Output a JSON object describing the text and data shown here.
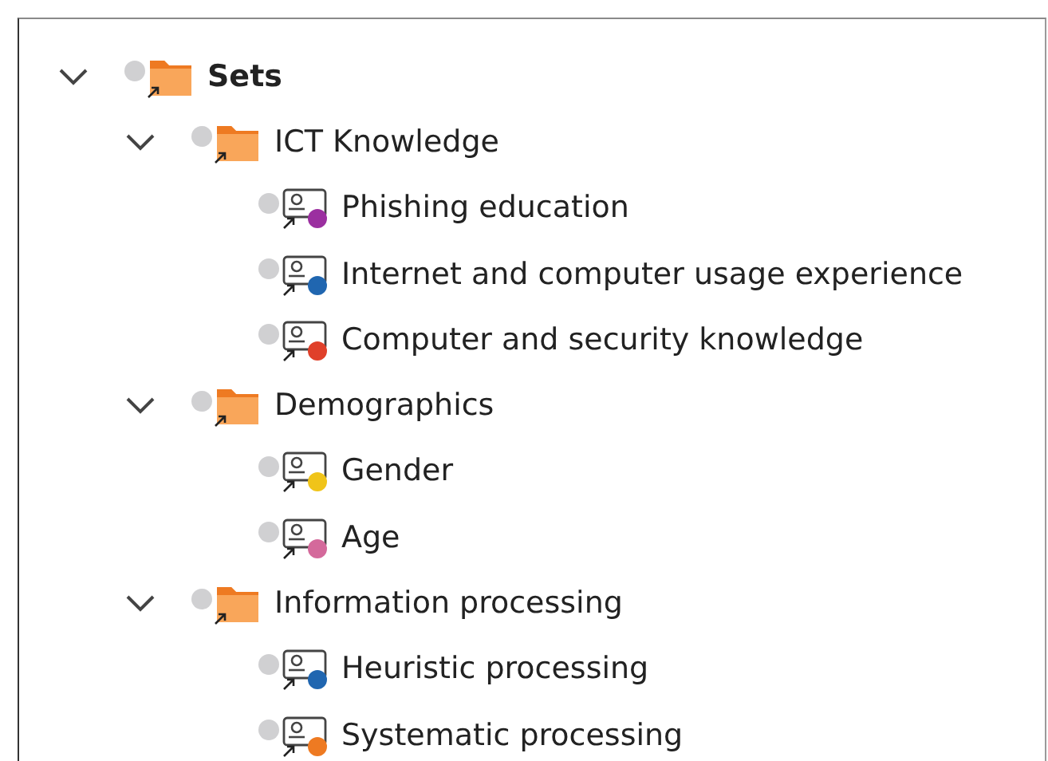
{
  "tree": [
    {
      "label": "Sets",
      "kind": "folder",
      "expanded": true,
      "children": [
        {
          "label": "ICT Knowledge",
          "kind": "folder",
          "expanded": true,
          "children": [
            {
              "label": "Phishing education",
              "kind": "set",
              "color": "#9b2fa0"
            },
            {
              "label": "Internet and computer usage experience",
              "kind": "set",
              "color": "#2066b0"
            },
            {
              "label": "Computer and security knowledge",
              "kind": "set",
              "color": "#e0402a"
            }
          ]
        },
        {
          "label": "Demographics",
          "kind": "folder",
          "expanded": true,
          "children": [
            {
              "label": "Gender",
              "kind": "set",
              "color": "#f0c419"
            },
            {
              "label": "Age",
              "kind": "set",
              "color": "#d4699b"
            }
          ]
        },
        {
          "label": "Information processing",
          "kind": "folder",
          "expanded": true,
          "children": [
            {
              "label": "Heuristic processing",
              "kind": "set",
              "color": "#2066b0"
            },
            {
              "label": "Systematic processing",
              "kind": "set",
              "color": "#ee7a22"
            }
          ]
        }
      ]
    }
  ]
}
